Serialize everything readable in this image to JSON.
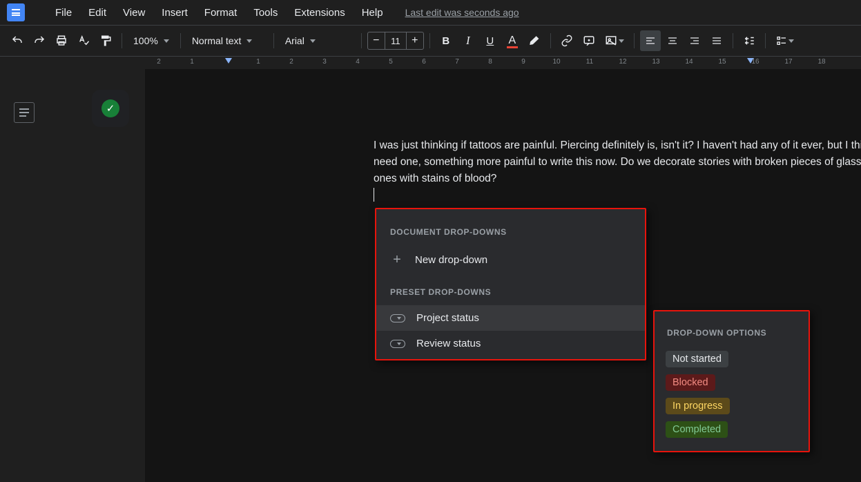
{
  "menubar": {
    "items": [
      "File",
      "Edit",
      "View",
      "Insert",
      "Format",
      "Tools",
      "Extensions",
      "Help"
    ],
    "last_edit": "Last edit was seconds ago"
  },
  "toolbar": {
    "zoom": "100%",
    "style": "Normal text",
    "font": "Arial",
    "font_size": "11"
  },
  "ruler": {
    "ticks": [
      "2",
      "1",
      "",
      "1",
      "2",
      "3",
      "4",
      "5",
      "6",
      "7",
      "8",
      "9",
      "10",
      "11",
      "12",
      "13",
      "14",
      "15",
      "16",
      "17",
      "18"
    ]
  },
  "document": {
    "body_text": "I was just thinking if tattoos are painful. Piercing definitely is, isn't it? I haven't had any of it ever, but I think I need one, something more painful to write this now. Do we decorate stories with broken pieces of glass, the ones with stains of blood?"
  },
  "dropdown_menu": {
    "heading_document": "DOCUMENT DROP-DOWNS",
    "new_dropdown": "New drop-down",
    "heading_preset": "PRESET DROP-DOWNS",
    "preset_items": [
      "Project status",
      "Review status"
    ]
  },
  "dropdown_options": {
    "heading": "DROP-DOWN OPTIONS",
    "options": [
      {
        "label": "Not started",
        "class": "chip-grey"
      },
      {
        "label": "Blocked",
        "class": "chip-red"
      },
      {
        "label": "In progress",
        "class": "chip-yellow"
      },
      {
        "label": "Completed",
        "class": "chip-green"
      }
    ]
  }
}
